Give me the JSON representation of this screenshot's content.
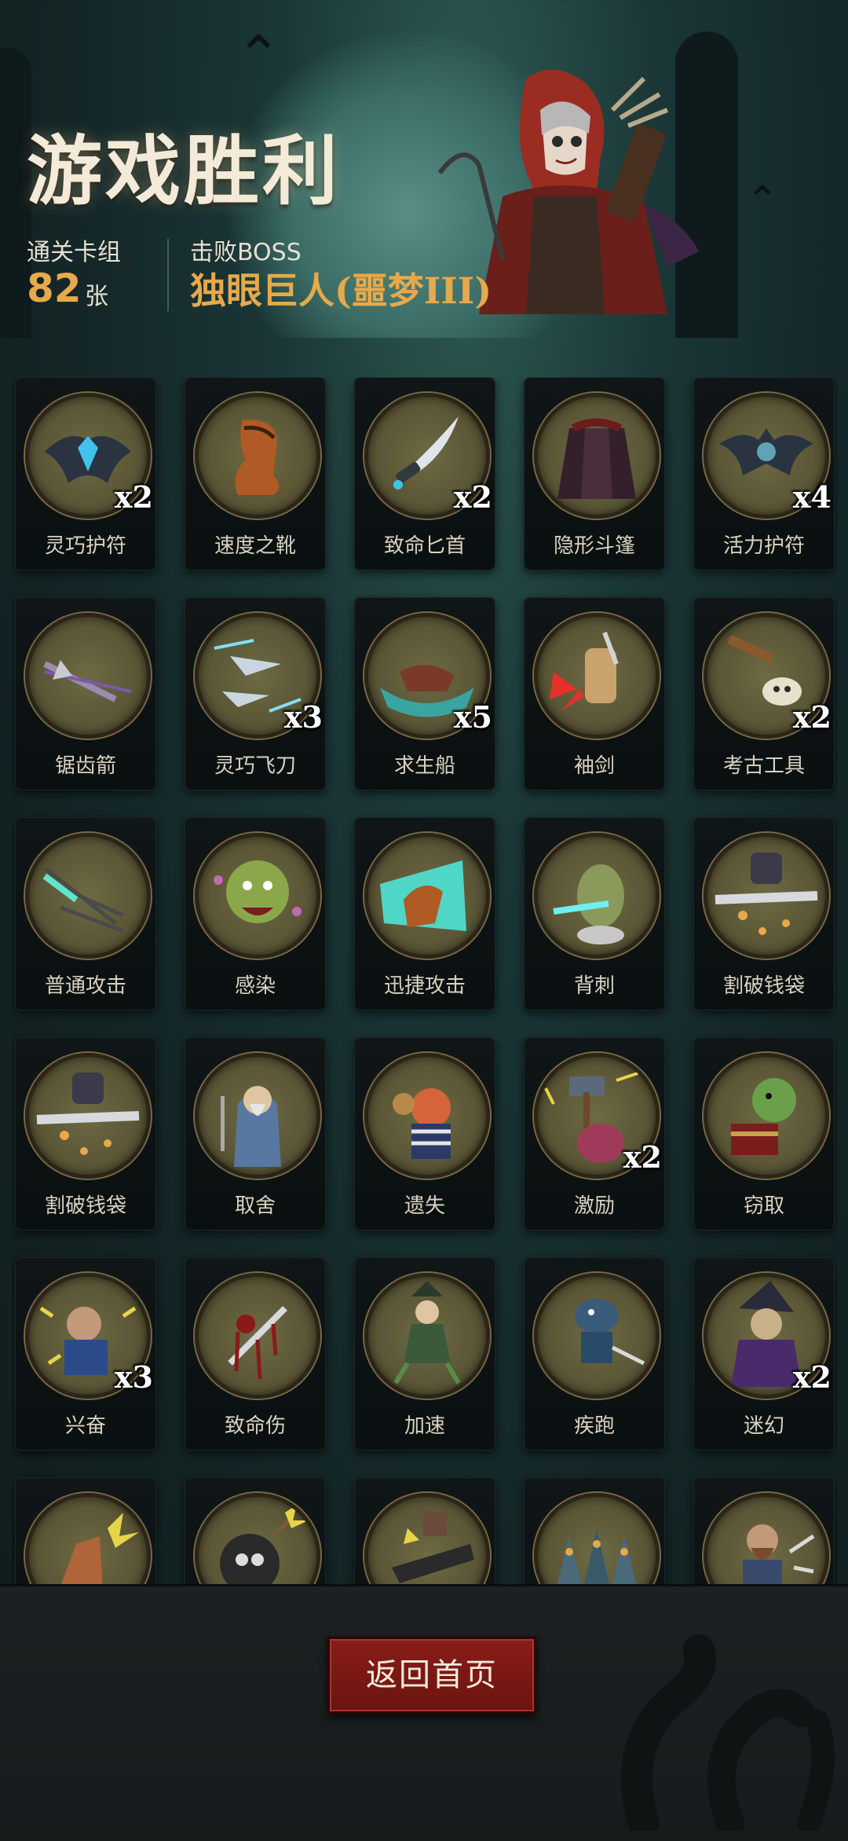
{
  "header": {
    "title": "游戏胜利",
    "deck_label": "通关卡组",
    "deck_count": "82",
    "deck_unit": "张",
    "boss_label": "击败BOSS",
    "boss_name": "独眼巨人(噩梦III)"
  },
  "cards": [
    {
      "label": "灵巧护符",
      "count": "x2",
      "icon": "bat-amulet-icon"
    },
    {
      "label": "速度之靴",
      "count": "",
      "icon": "boot-icon"
    },
    {
      "label": "致命匕首",
      "count": "x2",
      "icon": "dagger-icon"
    },
    {
      "label": "隐形斗篷",
      "count": "",
      "icon": "cloak-icon"
    },
    {
      "label": "活力护符",
      "count": "x4",
      "icon": "bat-gem-icon"
    },
    {
      "label": "锯齿箭",
      "count": "",
      "icon": "arrow-icon"
    },
    {
      "label": "灵巧飞刀",
      "count": "x3",
      "icon": "throwing-knife-icon"
    },
    {
      "label": "求生船",
      "count": "x5",
      "icon": "boat-icon"
    },
    {
      "label": "袖剑",
      "count": "",
      "icon": "sleeve-blade-icon"
    },
    {
      "label": "考古工具",
      "count": "x2",
      "icon": "tools-skull-icon"
    },
    {
      "label": "普通攻击",
      "count": "",
      "icon": "arrow-volley-icon"
    },
    {
      "label": "感染",
      "count": "",
      "icon": "goblin-icon"
    },
    {
      "label": "迅捷攻击",
      "count": "",
      "icon": "swift-strike-icon"
    },
    {
      "label": "背刺",
      "count": "",
      "icon": "backstab-icon"
    },
    {
      "label": "割破钱袋",
      "count": "",
      "icon": "cut-purse-icon"
    },
    {
      "label": "割破钱袋",
      "count": "",
      "icon": "cut-purse-icon"
    },
    {
      "label": "取舍",
      "count": "",
      "icon": "old-man-icon"
    },
    {
      "label": "遗失",
      "count": "",
      "icon": "pirate-icon"
    },
    {
      "label": "激励",
      "count": "x2",
      "icon": "hammer-icon"
    },
    {
      "label": "窃取",
      "count": "",
      "icon": "goblin-chest-icon"
    },
    {
      "label": "兴奋",
      "count": "x3",
      "icon": "excited-icon"
    },
    {
      "label": "致命伤",
      "count": "",
      "icon": "blood-blade-icon"
    },
    {
      "label": "加速",
      "count": "",
      "icon": "witch-run-icon"
    },
    {
      "label": "疾跑",
      "count": "",
      "icon": "runner-icon"
    },
    {
      "label": "迷幻",
      "count": "x2",
      "icon": "witch-icon"
    },
    {
      "label": "",
      "count": "",
      "icon": "punch-icon"
    },
    {
      "label": "",
      "count": "",
      "icon": "bomb-icon"
    },
    {
      "label": "",
      "count": "",
      "icon": "gun-icon"
    },
    {
      "label": "",
      "count": "",
      "icon": "hooded-crowd-icon"
    },
    {
      "label": "",
      "count": "",
      "icon": "dwarf-icon"
    }
  ],
  "footer": {
    "back_label": "返回首页"
  },
  "colors": {
    "accent_gold": "#e7a94a",
    "button_red": "#7a1713",
    "medal_olive": "#5a5636"
  }
}
